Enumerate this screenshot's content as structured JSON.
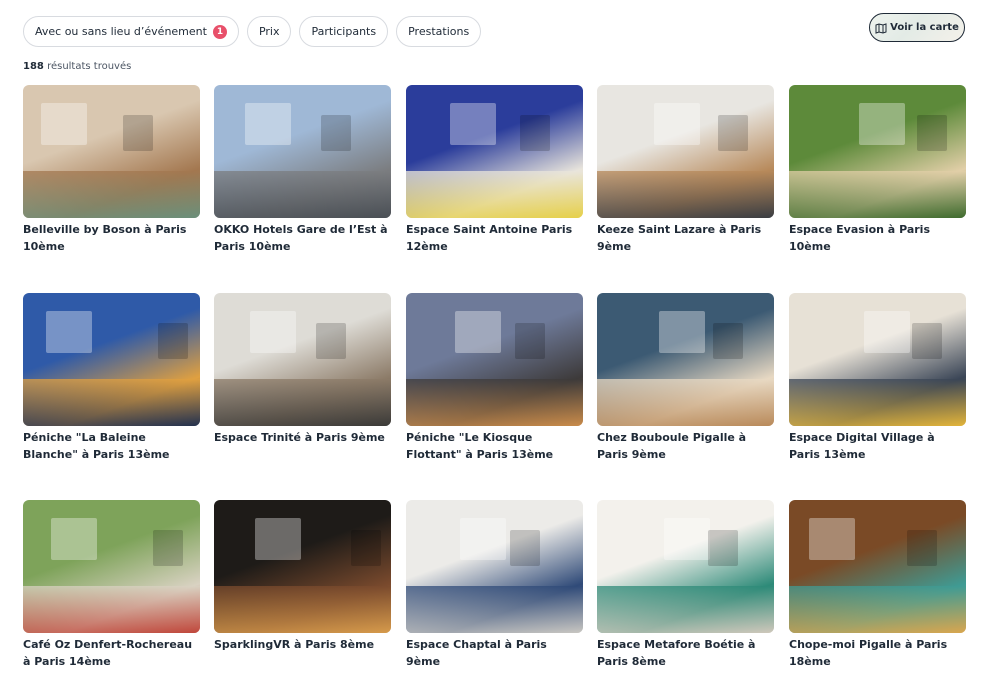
{
  "filters": {
    "event_place": {
      "label": "Avec ou sans lieu d’événement",
      "badge": "1"
    },
    "price": "Prix",
    "participants": "Participants",
    "services": "Prestations"
  },
  "map_button": {
    "label": "Voir la carte",
    "icon": "map-icon"
  },
  "results": {
    "count": "188",
    "text": "résultats trouvés"
  },
  "venues": [
    {
      "title": "Belleville by Boson à Paris 10ème",
      "colors": [
        "#d9c7b0",
        "#a3774f",
        "#6b8f7a"
      ]
    },
    {
      "title": "OKKO Hotels Gare de l’Est à Paris 10ème",
      "colors": [
        "#9fb8d6",
        "#7b7d80",
        "#4a4f55"
      ]
    },
    {
      "title": "Espace Saint Antoine Paris 12ème",
      "colors": [
        "#2b3d9b",
        "#e9e5dc",
        "#e6d04a"
      ]
    },
    {
      "title": "Keeze Saint Lazare à Paris 9ème",
      "colors": [
        "#e8e6e1",
        "#b7895a",
        "#3a3d42"
      ]
    },
    {
      "title": "Espace Evasion à Paris 10ème",
      "colors": [
        "#5d8a3a",
        "#e2cfa8",
        "#3f6b2e"
      ]
    },
    {
      "title": "Péniche \"La Baleine Blanche\" à Paris 13ème",
      "colors": [
        "#2f5aa8",
        "#e0a040",
        "#23314f"
      ]
    },
    {
      "title": "Espace Trinité à Paris 9ème",
      "colors": [
        "#dedcd6",
        "#8c7b68",
        "#3b3a38"
      ]
    },
    {
      "title": "Péniche \"Le Kiosque Flottant\" à Paris 13ème",
      "colors": [
        "#6e7a99",
        "#3d3a3a",
        "#c98b4a"
      ]
    },
    {
      "title": "Chez Bouboule Pigalle à Paris 9ème",
      "colors": [
        "#3c5a73",
        "#e8d9c3",
        "#b98a5a"
      ]
    },
    {
      "title": "Espace Digital Village à Paris 13ème",
      "colors": [
        "#e7e1d6",
        "#3a4556",
        "#e2b43a"
      ]
    },
    {
      "title": "Café Oz Denfert-Rochereau à Paris 14ème",
      "colors": [
        "#7ea35a",
        "#d9d2c2",
        "#c0473b"
      ]
    },
    {
      "title": "SparklingVR à Paris 8ème",
      "colors": [
        "#1e1b18",
        "#7a4a2d",
        "#d69a4b"
      ]
    },
    {
      "title": "Espace Chaptal à Paris 9ème",
      "colors": [
        "#ecebe8",
        "#2f4a78",
        "#c9c7c2"
      ]
    },
    {
      "title": "Espace Metafore Boétie à Paris 8ème",
      "colors": [
        "#f3f1ec",
        "#2d8a78",
        "#cfc8bb"
      ]
    },
    {
      "title": "Chope-moi Pigalle à Paris 18ème",
      "colors": [
        "#7a4a26",
        "#3f9b94",
        "#d9a64f"
      ]
    }
  ]
}
